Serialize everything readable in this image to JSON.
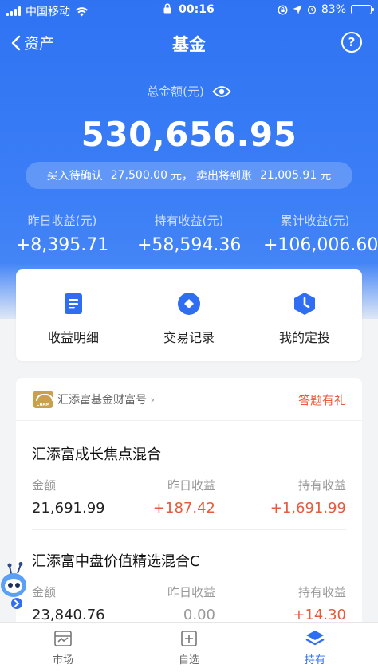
{
  "status_bar": {
    "carrier": "中国移动",
    "time": "00:16",
    "battery": "83%",
    "battery_level": 0.83
  },
  "nav": {
    "back_label": "资产",
    "title": "基金",
    "help_icon": "?"
  },
  "summary": {
    "total_label": "总金额(元)",
    "total_value": "530,656.95",
    "pending_buy_label": "买入待确认",
    "pending_buy_value": "27,500.00",
    "pending_buy_unit": "元，",
    "pending_sell_label": "卖出将到账",
    "pending_sell_value": "21,005.91",
    "pending_sell_unit": "元",
    "stats": [
      {
        "label": "昨日收益(元)",
        "value": "+8,395.71"
      },
      {
        "label": "持有收益(元)",
        "value": "+58,594.36"
      },
      {
        "label": "累计收益(元)",
        "value": "+106,006.60"
      }
    ]
  },
  "quick_actions": [
    {
      "label": "收益明细",
      "icon": "document-icon"
    },
    {
      "label": "交易记录",
      "icon": "diamond-icon"
    },
    {
      "label": "我的定投",
      "icon": "shield-clock-icon"
    }
  ],
  "fund_company": {
    "logo_text": "CUAM",
    "name": "汇添富基金财富号",
    "promo": "答题有礼"
  },
  "columns": {
    "amount": "金额",
    "yesterday": "昨日收益",
    "holding": "持有收益"
  },
  "funds": [
    {
      "name": "汇添富成长焦点混合",
      "amount": "21,691.99",
      "yesterday": "+187.42",
      "holding": "+1,691.99"
    },
    {
      "name": "汇添富中盘价值精选混合C",
      "amount": "23,840.76",
      "yesterday": "0.00",
      "holding": "+14.30"
    }
  ],
  "tabbar": [
    {
      "label": "市场",
      "icon": "market-icon"
    },
    {
      "label": "自选",
      "icon": "add-square-icon"
    },
    {
      "label": "持有",
      "icon": "layers-icon"
    }
  ],
  "colors": {
    "primary": "#2f6ef2",
    "gain": "#e85a3c",
    "muted": "#999999"
  }
}
